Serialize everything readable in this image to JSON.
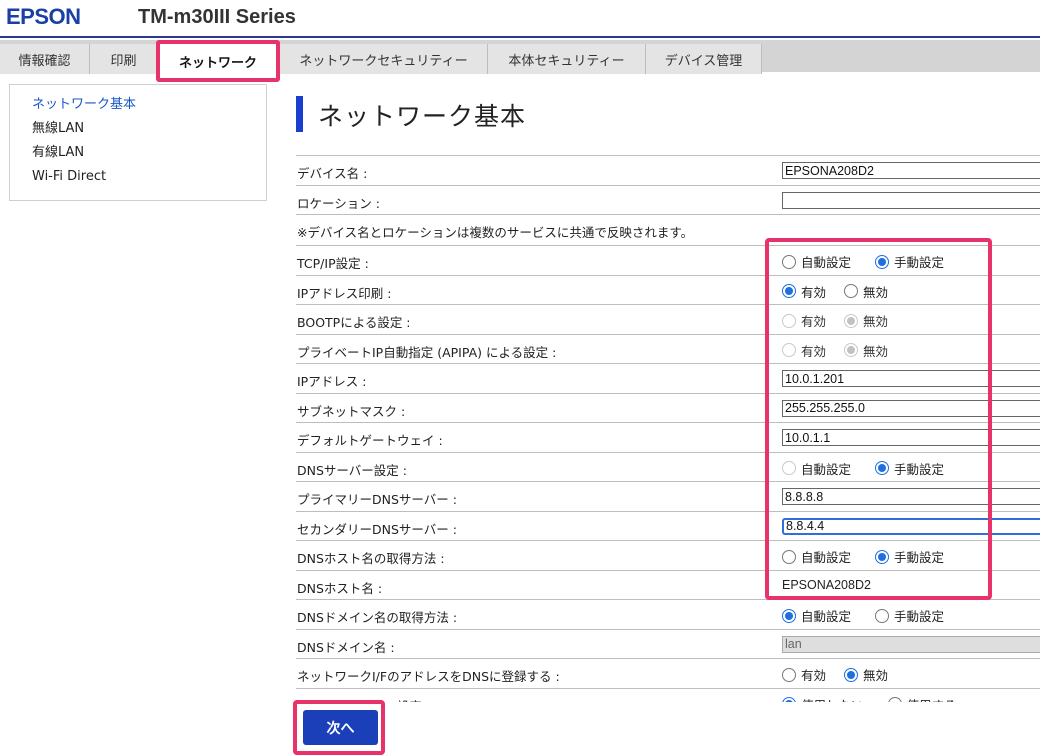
{
  "header": {
    "logo": "EPSON",
    "model": "TM-m30III Series"
  },
  "tabs": [
    {
      "label": "情報確認"
    },
    {
      "label": "印刷"
    },
    {
      "label": "ネットワーク"
    },
    {
      "label": "ネットワークセキュリティー"
    },
    {
      "label": "本体セキュリティー"
    },
    {
      "label": "デバイス管理"
    }
  ],
  "sidebar": {
    "items": [
      {
        "label": "ネットワーク基本"
      },
      {
        "label": "無線LAN"
      },
      {
        "label": "有線LAN"
      },
      {
        "label": "Wi-Fi Direct"
      }
    ]
  },
  "main": {
    "title": "ネットワーク基本",
    "device_name": {
      "label": "デバイス名 :",
      "value": "EPSONA208D2"
    },
    "location": {
      "label": "ロケーション :",
      "value": ""
    },
    "note": "※デバイス名とロケーションは複数のサービスに共通で反映されます。",
    "tcpip": {
      "label": "TCP/IP設定 :",
      "opt1": "自動設定",
      "opt2": "手動設定"
    },
    "ip_print": {
      "label": "IPアドレス印刷 :",
      "opt1": "有効",
      "opt2": "無効"
    },
    "bootp": {
      "label": "BOOTPによる設定 :",
      "opt1": "有効",
      "opt2": "無効"
    },
    "apipa": {
      "label": "プライベートIP自動指定 (APIPA) による設定 :",
      "opt1": "有効",
      "opt2": "無効"
    },
    "ip_address": {
      "label": "IPアドレス :",
      "value": "10.0.1.201"
    },
    "subnet": {
      "label": "サブネットマスク :",
      "value": "255.255.255.0"
    },
    "gateway": {
      "label": "デフォルトゲートウェイ :",
      "value": "10.0.1.1"
    },
    "dns_setting": {
      "label": "DNSサーバー設定 :",
      "opt1": "自動設定",
      "opt2": "手動設定"
    },
    "dns_primary": {
      "label": "プライマリーDNSサーバー :",
      "value": "8.8.8.8"
    },
    "dns_secondary": {
      "label": "セカンダリーDNSサーバー :",
      "value": "8.8.4.4"
    },
    "dns_host_method": {
      "label": "DNSホスト名の取得方法 :",
      "opt1": "自動設定",
      "opt2": "手動設定"
    },
    "dns_host": {
      "label": "DNSホスト名 :",
      "value": "EPSONA208D2"
    },
    "dns_domain_method": {
      "label": "DNSドメイン名の取得方法 :",
      "opt1": "自動設定",
      "opt2": "手動設定"
    },
    "dns_domain": {
      "label": "DNSドメイン名 :",
      "value": "lan"
    },
    "dns_register": {
      "label": "ネットワークI/FのアドレスをDNSに登録する :",
      "opt1": "有効",
      "opt2": "無効"
    },
    "proxy": {
      "label": "プロキシサーバー設定 :",
      "opt1": "使用しない",
      "opt2": "使用する"
    }
  },
  "next_button": "次へ"
}
